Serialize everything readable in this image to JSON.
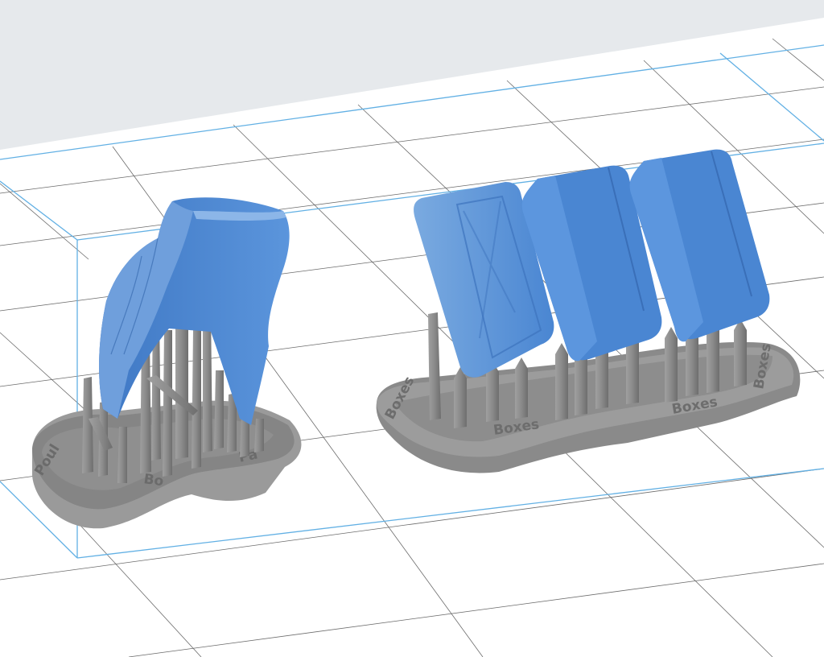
{
  "viewer": {
    "background_color": "#e6e9ec",
    "build_plate_color": "#ffffff",
    "grid_line_color": "#3a3a3a",
    "build_volume_color": "#62b0e4",
    "model_color": "#4a86d2",
    "support_color": "#8e8e8e"
  },
  "models": [
    {
      "name": "curved-panel-part",
      "base_labels": [
        "Poul",
        "Bo",
        "Pa"
      ]
    },
    {
      "name": "jerrycan-parts",
      "base_labels": [
        "Boxes",
        "Boxes",
        "Boxes",
        "Boxes"
      ]
    }
  ]
}
